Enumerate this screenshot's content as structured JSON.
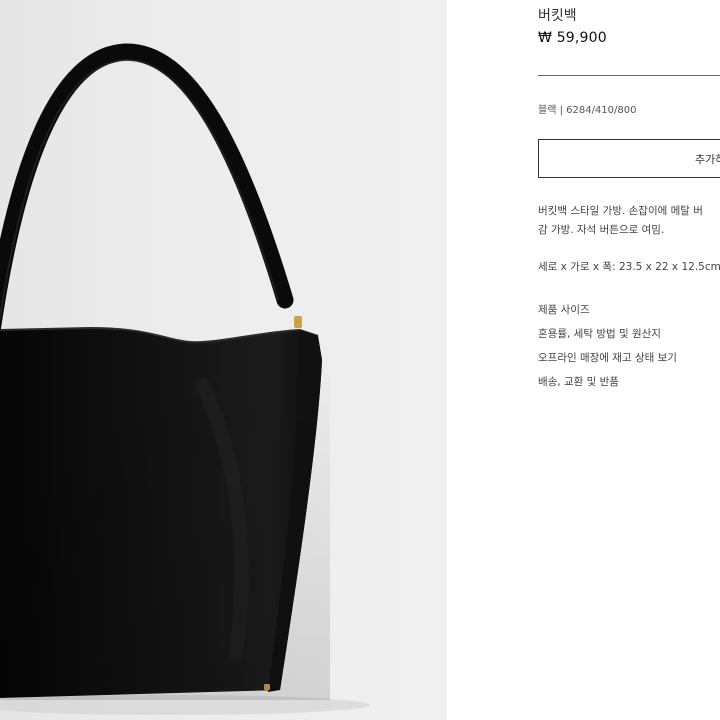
{
  "product": {
    "image_alt": "black bucket bag",
    "title": "버킷백",
    "price": "₩ 59,900",
    "meta": "블랙 | 6284/410/800",
    "add_button_label": "추가하",
    "description_line1": "버킷백 스타일 가방. 손잡이에 메탈 버",
    "description_line2": "감 가방. 자석 버튼으로 여밈.",
    "dimensions": "세로 x 가로 x 폭: 23.5 x 22 x 12.5cm"
  },
  "links": [
    {
      "label": "제품 사이즈"
    },
    {
      "label": "혼용률, 세탁 방법 및 원산지"
    },
    {
      "label": "오프라인 매장에 재고 상태 보기"
    },
    {
      "label": "배송, 교환 및 반품"
    }
  ],
  "colors": {
    "bag": "#0d0d0d",
    "background": "#ececec",
    "accent_hardware": "#c9a24a"
  }
}
